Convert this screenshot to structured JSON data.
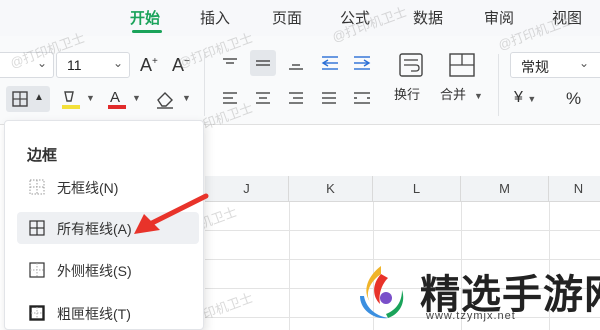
{
  "tabs": [
    {
      "label": "开始",
      "active": true
    },
    {
      "label": "插入"
    },
    {
      "label": "页面"
    },
    {
      "label": "公式"
    },
    {
      "label": "数据"
    },
    {
      "label": "审阅"
    },
    {
      "label": "视图"
    }
  ],
  "toolbar": {
    "font_size": "11",
    "increase_font": "A",
    "decrease_font": "A",
    "wrap_label": "换行",
    "merge_label": "合并",
    "number_format": "常规",
    "currency_symbol": "¥",
    "percent_symbol": "%"
  },
  "border_menu": {
    "title": "边框",
    "items": [
      {
        "label": "无框线(N)",
        "icon": "no-border-icon"
      },
      {
        "label": "所有框线(A)",
        "icon": "all-borders-icon",
        "hover": true
      },
      {
        "label": "外侧框线(S)",
        "icon": "outside-borders-icon"
      },
      {
        "label": "粗匣框线(T)",
        "icon": "thick-box-border-icon"
      }
    ]
  },
  "columns": [
    "J",
    "K",
    "L",
    "M",
    "N"
  ],
  "watermark": "@打印机卫士",
  "logo": {
    "name": "精选手游网",
    "url": "www.tzymjx.net"
  },
  "colors": {
    "accent": "#1aa35a",
    "arrow": "#e8332a",
    "font_color": "#e12b2b",
    "highlight": "#f3e03a"
  }
}
